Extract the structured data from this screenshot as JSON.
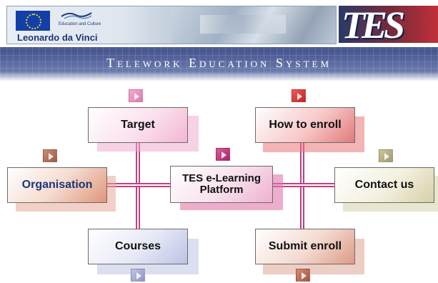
{
  "header": {
    "program_line": "Education and Culture",
    "program_name": "Leonardo da Vinci",
    "logo_text": "TES",
    "banner_title": "Telework Education System"
  },
  "menu": {
    "center": "TES e-Learning Platform",
    "target": "Target",
    "how_to_enroll": "How to enroll",
    "organisation": "Organisation",
    "contact_us": "Contact us",
    "courses": "Courses",
    "submit_enroll": "Submit enroll"
  },
  "colors": {
    "connector": "#c63d7f",
    "organisation_text": "#1a3577",
    "banner": "#4f5f96"
  }
}
